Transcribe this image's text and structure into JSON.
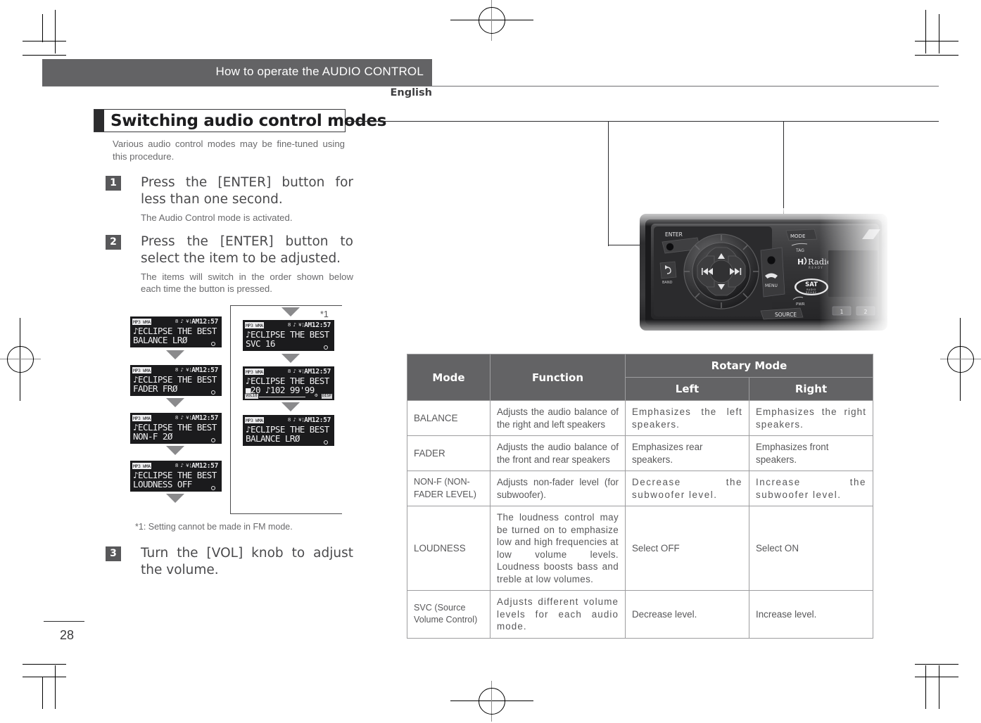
{
  "header": {
    "title": "How to operate the AUDIO CONTROL",
    "language": "English"
  },
  "section": {
    "heading": "Switching audio control modes",
    "intro": "Various audio control modes may be fine-tuned using this procedure."
  },
  "steps": [
    {
      "number": "1",
      "title": "Press the [ENTER] button for less than one second.",
      "body": "The Audio Control mode is activated."
    },
    {
      "number": "2",
      "title": "Press the [ENTER] button to select the item to be adjusted.",
      "body": "The items will switch in the order shown below each time the button is pressed."
    },
    {
      "number": "3",
      "title": "Turn the [VOL] knob to adjust the volume.",
      "body": ""
    }
  ],
  "flow": {
    "footnote_marker": "*1",
    "footnote": "*1: Setting cannot be made in FM mode.",
    "screens_left": [
      {
        "format": "MP3 WMA",
        "icons": "8 ♪ ¥¦",
        "clock": "AM12:57",
        "line1": "♪ECLIPSE THE BEST",
        "line2": "BALANCE  LRØ",
        "dot": true,
        "vol": false
      },
      {
        "format": "MP3 WMA",
        "icons": "8 ♪ ¥¦",
        "clock": "AM12:57",
        "line1": "♪ECLIPSE THE BEST",
        "line2": "FADER    FRØ",
        "dot": true,
        "vol": false
      },
      {
        "format": "MP3 WMA",
        "icons": "8 ♪ ¥¦",
        "clock": "AM12:57",
        "line1": "♪ECLIPSE THE BEST",
        "line2": "NON-F     2Ø",
        "dot": true,
        "vol": false
      },
      {
        "format": "MP3 WMA",
        "icons": "8 ♪ ¥¦",
        "clock": "AM12:57",
        "line1": "♪ECLIPSE THE BEST",
        "line2": "LOUDNESS OFF",
        "dot": true,
        "vol": false
      }
    ],
    "screens_right": [
      {
        "format": "MP3 WMA",
        "icons": "8 ♪ ¥¦",
        "clock": "AM12:57",
        "line1": "♪ECLIPSE THE BEST",
        "line2": "SVC      16",
        "dot": true,
        "vol": false
      },
      {
        "format": "MP3 WMA",
        "icons": "8 ♪ ¥¦",
        "clock": "AM12:57",
        "line1": "♪ECLIPSE THE BEST",
        "line2": "■20  ♪102   99'99",
        "dot": false,
        "vol": true,
        "vol_label": "VOL10",
        "vol_badge": "DISP"
      },
      {
        "format": "MP3 WMA",
        "icons": "8 ♪ ¥¦",
        "clock": "AM12:57",
        "line1": "♪ECLIPSE THE BEST",
        "line2": "BALANCE  LRØ",
        "dot": true,
        "vol": false
      }
    ]
  },
  "table": {
    "headers": {
      "mode": "Mode",
      "function": "Function",
      "rotary": "Rotary Mode",
      "left": "Left",
      "right": "Right"
    },
    "rows": [
      {
        "mode": "BALANCE",
        "function": "Adjusts the audio balance of the right and left speakers",
        "left": "Emphasizes the left speakers.",
        "right": "Emphasizes the right speakers."
      },
      {
        "mode": "FADER",
        "function": "Adjusts the audio balance of the front and rear speakers",
        "left": "Emphasizes rear speakers.",
        "right": "Emphasizes front speakers."
      },
      {
        "mode": "NON-F (NON-FADER LEVEL)",
        "function": "Adjusts non-fader level (for subwoofer).",
        "left": "Decrease the subwoofer level.",
        "right": "Increase the subwoofer level."
      },
      {
        "mode": "LOUDNESS",
        "function": "The loudness control may be turned on to emphasize low and high frequencies at low volume levels. Loudness boosts bass and treble at low volumes.",
        "left": "Select OFF",
        "right": "Select ON"
      },
      {
        "mode": "SVC (Source Volume Control)",
        "function": "Adjusts different volume levels for each audio mode.",
        "left": "Decrease level.",
        "right": "Increase level."
      }
    ]
  },
  "head_unit": {
    "labels": {
      "enter": "ENTER",
      "mode": "MODE",
      "tag": "TAG",
      "menu": "MENU",
      "band": "BAND",
      "pwr": "PWR",
      "source": "SOURCE",
      "hd_radio": "HD Radio",
      "hd_radio_sub": "READY",
      "sat": "SAT",
      "sat_sub1": "RADIO",
      "sat_sub2": "READY",
      "preset1": "1",
      "preset2": "2"
    }
  },
  "page": {
    "number": "28"
  }
}
